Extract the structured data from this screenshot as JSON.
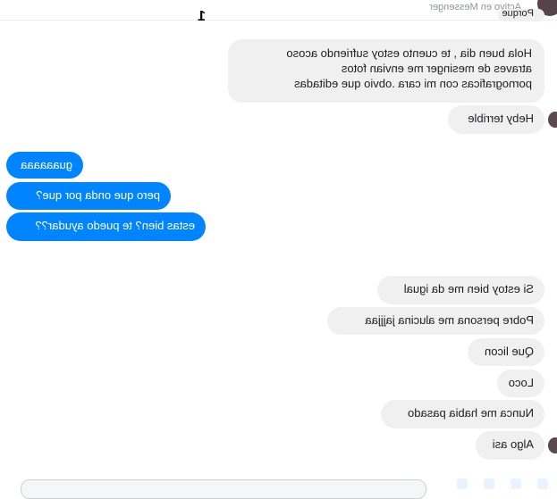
{
  "header": {
    "status": "Activo en Messenger",
    "counter": "1"
  },
  "messages": {
    "m0": "Porque",
    "m1": "Hola buen dia , te cuento estoy sufriendo acoso\natraves de mesinger me envian fotos\npornograficas con mi cara .obvio que editadas",
    "m2": "Heby terrible",
    "m3": "guaaaaaa",
    "m4": "pero que onda por que?",
    "m5": "estas bien? te puedo ayudar??",
    "m6": "Si estoy bien me da igual",
    "m7": "Pobre persona me alucina jajjjaa",
    "m8": "Que licon",
    "m9": "Loco",
    "m10": "Nunca me habia pasado",
    "m11": "Algo asi"
  },
  "colors": {
    "incoming": "#f1f0f0",
    "outgoing": "#0084ff"
  },
  "icons": {
    "avatar": "contact-avatar",
    "send": "send-icon"
  }
}
